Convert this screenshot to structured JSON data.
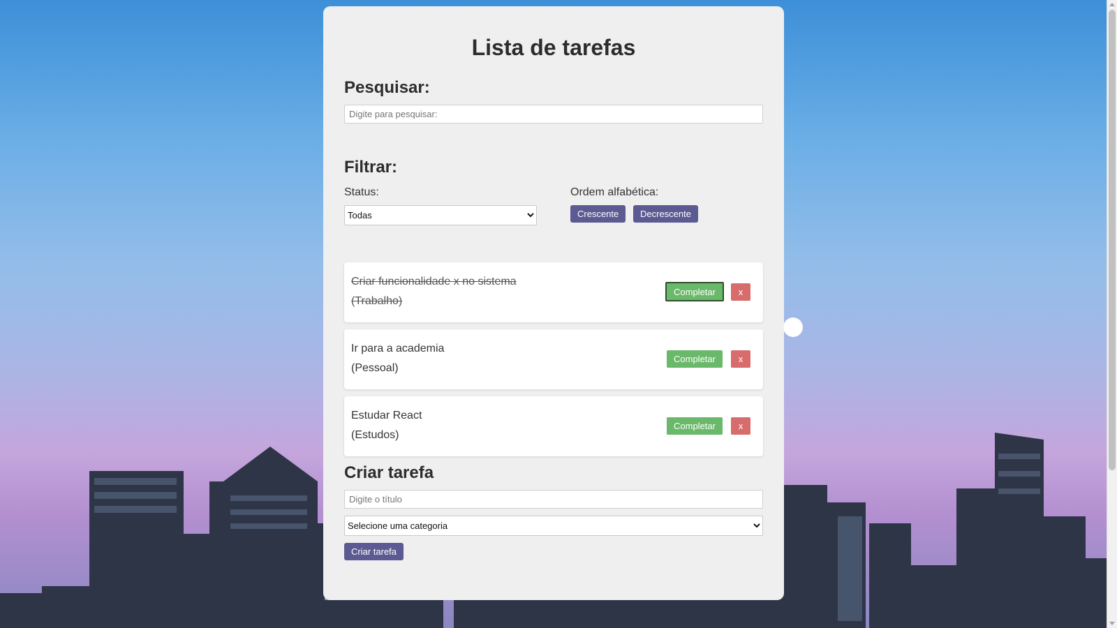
{
  "app": {
    "title": "Lista de tarefas"
  },
  "search": {
    "heading": "Pesquisar:",
    "placeholder": "Digite para pesquisar:",
    "value": ""
  },
  "filter": {
    "heading": "Filtrar:",
    "status_label": "Status:",
    "status_selected": "Todas",
    "order_label": "Ordem alfabética:",
    "asc_label": "Crescente",
    "desc_label": "Decrescente"
  },
  "todos": [
    {
      "title": "Criar funcionalidade x no sistema",
      "category": "(Trabalho)",
      "completed": true,
      "complete_label": "Completar",
      "remove_label": "x"
    },
    {
      "title": "Ir para a academia",
      "category": "(Pessoal)",
      "completed": false,
      "complete_label": "Completar",
      "remove_label": "x"
    },
    {
      "title": "Estudar React",
      "category": "(Estudos)",
      "completed": false,
      "complete_label": "Completar",
      "remove_label": "x"
    }
  ],
  "create": {
    "heading": "Criar tarefa",
    "title_placeholder": "Digite o título",
    "title_value": "",
    "category_selected": "Selecione uma categoria",
    "submit_label": "Criar tarefa"
  },
  "colors": {
    "primary_button": "#5b5a93",
    "complete_button": "#6ab86a",
    "remove_button": "#d86c6c",
    "card_background": "#efefef"
  }
}
